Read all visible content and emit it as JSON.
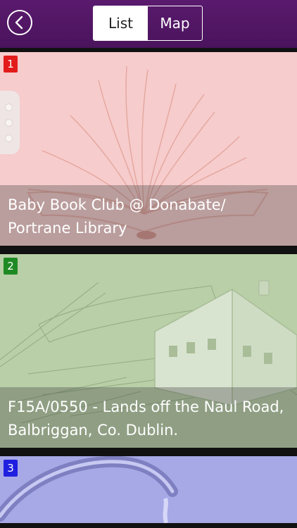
{
  "header": {
    "tabs": [
      {
        "label": "List",
        "active": true
      },
      {
        "label": "Map",
        "active": false
      }
    ]
  },
  "items": [
    {
      "number": "1",
      "title": "Baby Book Club @ Donabate/ Portrane Library",
      "badge_color": "#e21b1b"
    },
    {
      "number": "2",
      "title": "F15A/0550 - Lands off the Naul Road, Balbriggan, Co. Dublin.",
      "badge_color": "#1f8a24"
    },
    {
      "number": "3",
      "title": "",
      "badge_color": "#1f1fe0"
    }
  ],
  "colors": {
    "header": "#4d155f",
    "accent_card1": "#f6cccc",
    "accent_card2": "#b9cfa7",
    "accent_card3": "#a7a8e6"
  }
}
